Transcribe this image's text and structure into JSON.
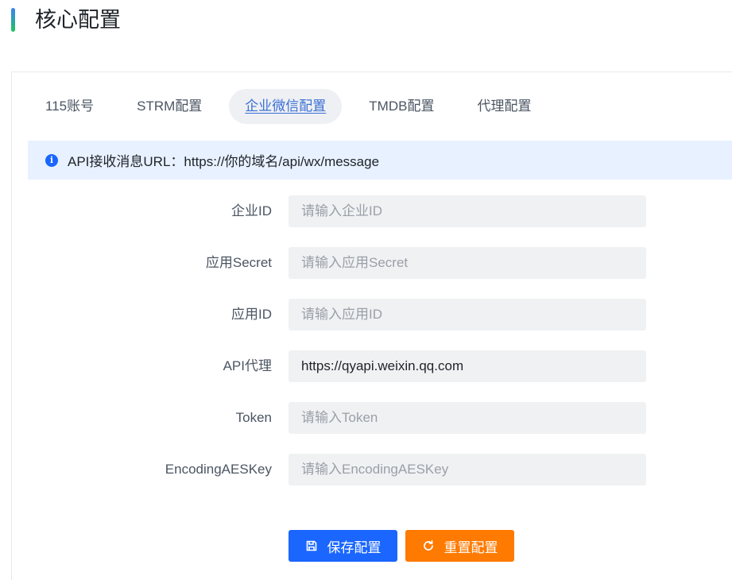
{
  "header": {
    "title": "核心配置"
  },
  "tabs": [
    {
      "label": "115账号"
    },
    {
      "label": "STRM配置"
    },
    {
      "label": "企业微信配置"
    },
    {
      "label": "TMDB配置"
    },
    {
      "label": "代理配置"
    }
  ],
  "active_tab": "企业微信配置",
  "alert": {
    "text": "API接收消息URL：https://你的域名/api/wx/message",
    "icon": "info-icon"
  },
  "form": {
    "corp_id": {
      "label": "企业ID",
      "value": "",
      "placeholder": "请输入企业ID"
    },
    "app_secret": {
      "label": "应用Secret",
      "value": "",
      "placeholder": "请输入应用Secret"
    },
    "app_id": {
      "label": "应用ID",
      "value": "",
      "placeholder": "请输入应用ID"
    },
    "api_proxy": {
      "label": "API代理",
      "value": "https://qyapi.weixin.qq.com",
      "placeholder": ""
    },
    "token": {
      "label": "Token",
      "value": "",
      "placeholder": "请输入Token"
    },
    "aes_key": {
      "label": "EncodingAESKey",
      "value": "",
      "placeholder": "请输入EncodingAESKey"
    }
  },
  "buttons": {
    "save": {
      "label": "保存配置",
      "icon": "save-icon",
      "color": "#1a66ff"
    },
    "reset": {
      "label": "重置配置",
      "icon": "refresh-icon",
      "color": "#ff7a00"
    }
  }
}
